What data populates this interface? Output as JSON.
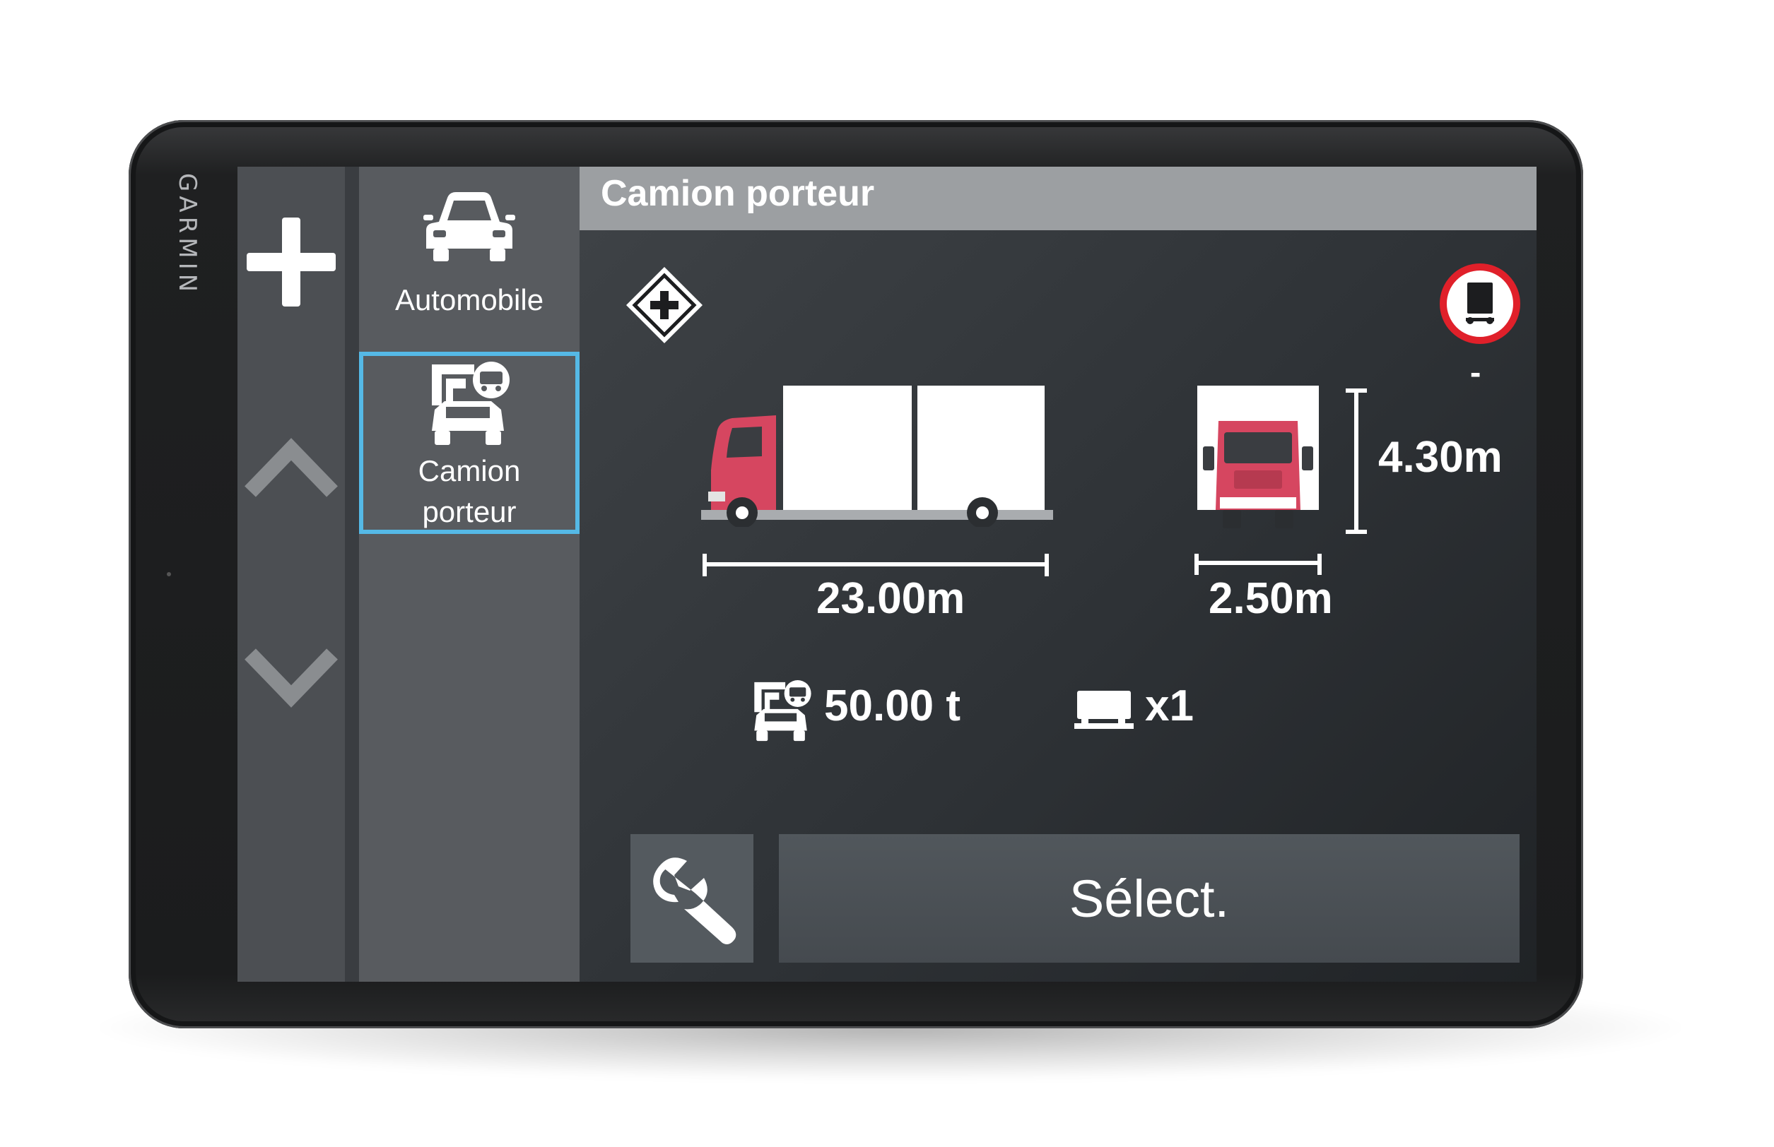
{
  "device": {
    "brand": "GARMIN"
  },
  "profiles": [
    {
      "label": "Automobile",
      "icon": "car-icon",
      "selected": false
    },
    {
      "label": "Camion porteur",
      "label_line1": "Camion",
      "label_line2": "porteur",
      "icon": "truck-profile-icon",
      "selected": true
    }
  ],
  "rail": {
    "add": "plus-icon",
    "up": "chevron-up-icon",
    "down": "chevron-down-icon"
  },
  "panel": {
    "title": "Camion porteur",
    "length": "23.00m",
    "width": "2.50m",
    "height": "4.30m",
    "weight": "50.00 t",
    "trailers": "x1",
    "hazmat": "-",
    "select_label": "Sélect."
  },
  "colors": {
    "accent": "#55b9e6",
    "truck": "#d64660",
    "sign_red": "#e0202a"
  }
}
